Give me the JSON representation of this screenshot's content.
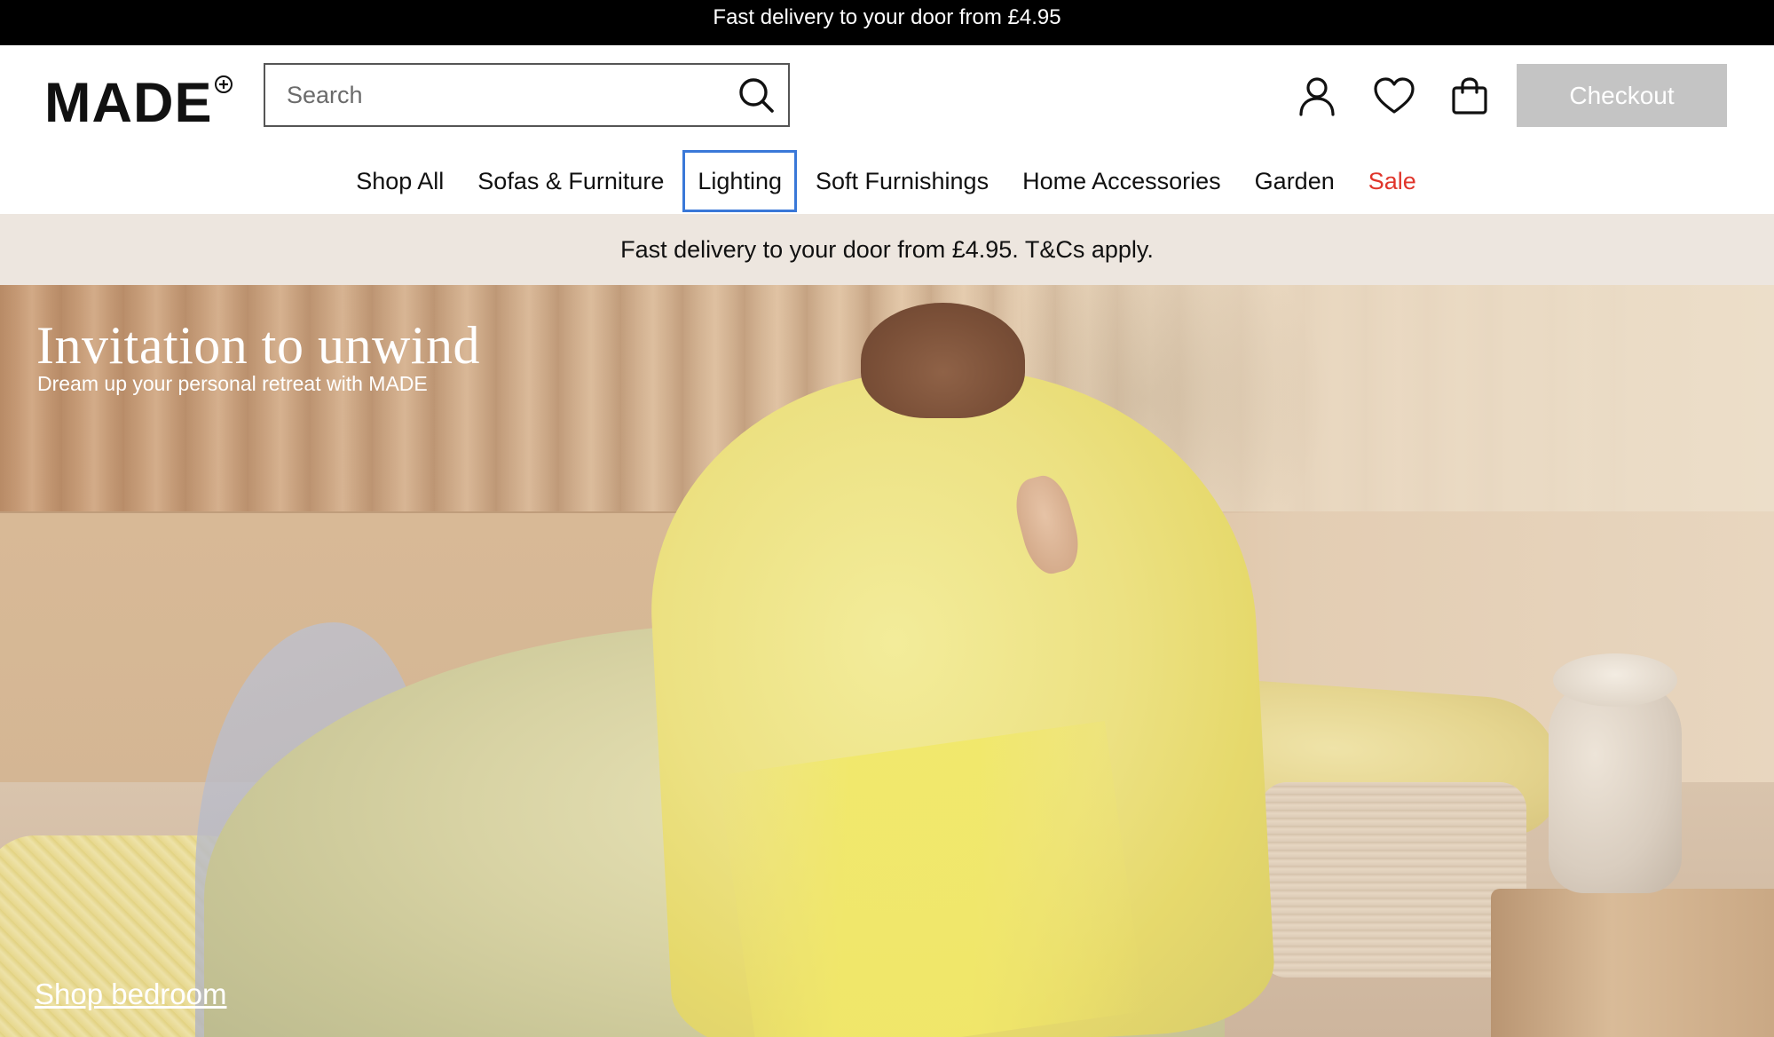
{
  "top_bar": {
    "text": "Fast delivery to your door from £4.95"
  },
  "header": {
    "logo": "MADE",
    "logo_mark": "+",
    "search": {
      "placeholder": "Search",
      "value": ""
    },
    "icons": {
      "account": "user-icon",
      "wishlist": "heart-icon",
      "bag": "shopping-bag-icon",
      "search": "search-icon"
    },
    "checkout_label": "Checkout"
  },
  "nav": {
    "items": [
      {
        "label": "Shop All"
      },
      {
        "label": "Sofas & Furniture"
      },
      {
        "label": "Lighting",
        "focused": true
      },
      {
        "label": "Soft Furnishings"
      },
      {
        "label": "Home Accessories"
      },
      {
        "label": "Garden"
      },
      {
        "label": "Sale",
        "color": "#e0352b"
      }
    ]
  },
  "delivery_band": {
    "text": "Fast delivery to your door from £4.95. T&Cs apply."
  },
  "hero": {
    "title": "Invitation to unwind",
    "subtitle": "Dream up your personal retreat with MADE",
    "cta": "Shop bedroom"
  },
  "colors": {
    "checkout_bg": "#c4c4c4",
    "delivery_band_bg": "#ede6df",
    "focus_outline": "#3a78d8",
    "sale": "#e0352b"
  }
}
